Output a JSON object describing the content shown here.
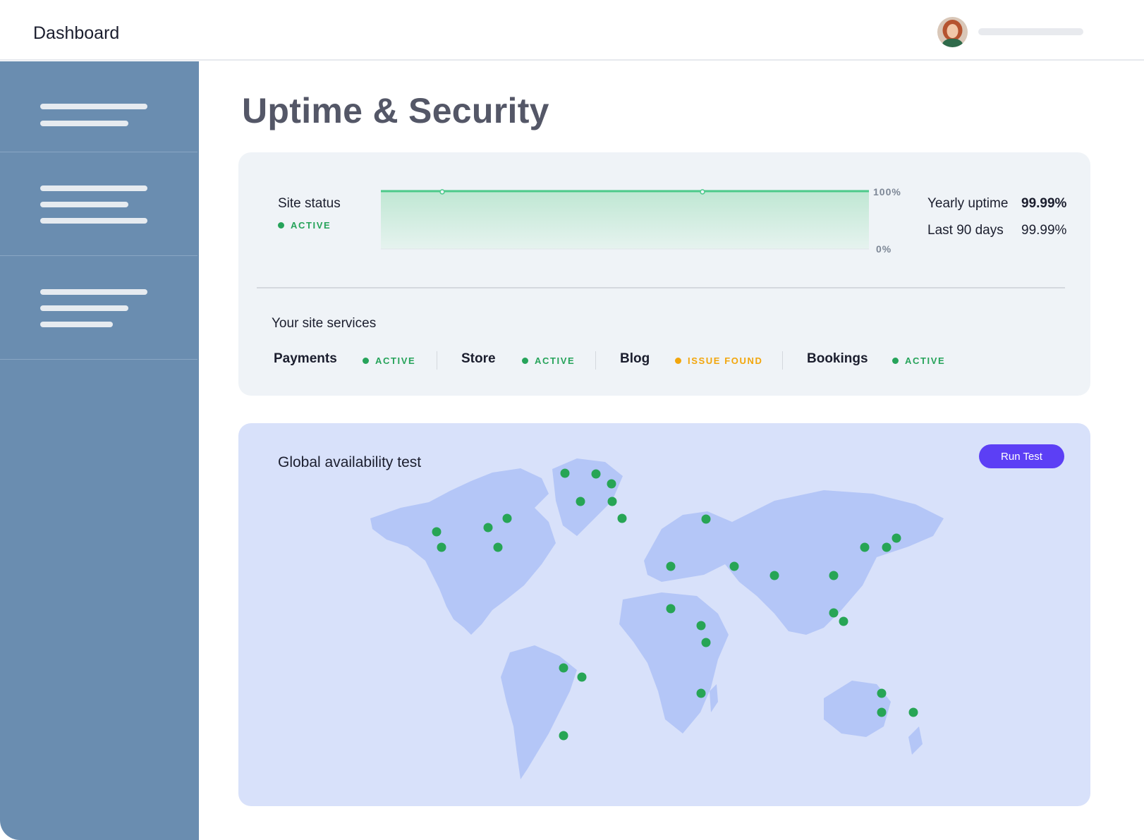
{
  "header": {
    "title": "Dashboard"
  },
  "page": {
    "title": "Uptime & Security"
  },
  "status": {
    "label": "Site status",
    "state": "ACTIVE",
    "chart_max_label": "100%",
    "chart_min_label": "0%",
    "uptime_percent": 100,
    "yearly_label": "Yearly uptime",
    "yearly_value": "99.99%",
    "last90_label": "Last 90 days",
    "last90_value": "99.99%"
  },
  "services": {
    "title": "Your site services",
    "items": [
      {
        "name": "Payments",
        "status": "ACTIVE"
      },
      {
        "name": "Store",
        "status": "ACTIVE"
      },
      {
        "name": "Blog",
        "status": "ISSUE FOUND"
      },
      {
        "name": "Bookings",
        "status": "ACTIVE"
      }
    ]
  },
  "availability": {
    "title": "Global availability test",
    "button_label": "Run Test"
  },
  "colors": {
    "sidebar": "#6a8db0",
    "active": "#26a35a",
    "issue": "#f2a60c",
    "accent": "#5c3ff5",
    "map_land": "#b4c6f7",
    "map_background": "#d8e1fa"
  }
}
